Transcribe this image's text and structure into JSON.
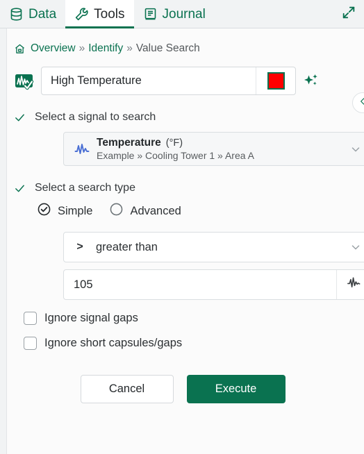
{
  "tabs": [
    {
      "label": "Data",
      "icon": "database-icon",
      "active": false
    },
    {
      "label": "Tools",
      "icon": "wrench-icon",
      "active": true
    },
    {
      "label": "Journal",
      "icon": "book-icon",
      "active": false
    }
  ],
  "window": {
    "expand_icon": "expand-arrows-icon",
    "collapse_handle_icon": "chevron-left-icon"
  },
  "breadcrumb": {
    "home_icon": "home-icon",
    "items": [
      {
        "label": "Overview",
        "link": true
      },
      {
        "label": "Identify",
        "link": true
      },
      {
        "label": "Value Search",
        "link": false
      }
    ],
    "separator": "»"
  },
  "tool": {
    "icon": "value-search-tool-icon",
    "name_value": "High Temperature",
    "name_placeholder": "Name",
    "color": "#ff0000",
    "color_border": "#0a7250",
    "ai_icon": "sparkles-icon"
  },
  "signal_section": {
    "check_icon": "checkmark-icon",
    "title": "Select a signal to search",
    "selected": {
      "icon": "signal-waveform-icon",
      "name": "Temperature",
      "unit": "(°F)",
      "path": "Example » Cooling Tower 1 » Area A"
    },
    "chevron_icon": "chevron-down-icon"
  },
  "search_type_section": {
    "check_icon": "checkmark-icon",
    "title": "Select a search type",
    "options": [
      {
        "label": "Simple",
        "selected": true
      },
      {
        "label": "Advanced",
        "selected": false
      }
    ],
    "operator": {
      "symbol": ">",
      "label": "greater than",
      "chevron_icon": "chevron-down-icon"
    },
    "value": {
      "text": "105",
      "placeholder": "Value",
      "picker_icon": "signal-waveform-icon"
    },
    "checkboxes": [
      {
        "label": "Ignore signal gaps",
        "checked": false
      },
      {
        "label": "Ignore short capsules/gaps",
        "checked": false
      }
    ]
  },
  "actions": {
    "cancel_label": "Cancel",
    "execute_label": "Execute"
  },
  "colors": {
    "brand_green": "#0a7250",
    "signal_blue": "#4a6fd4",
    "panel_bg": "#fbfbfb",
    "tabbar_bg": "#f1f3f4"
  }
}
